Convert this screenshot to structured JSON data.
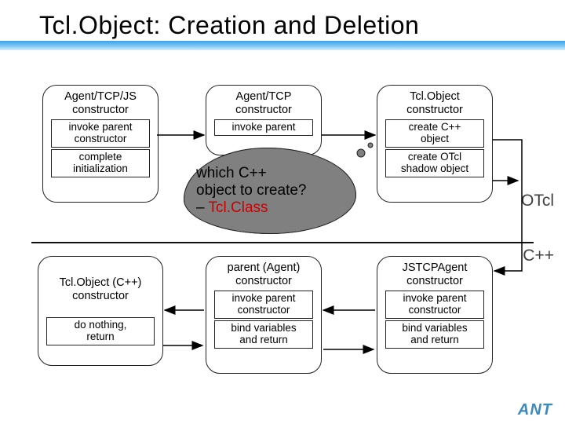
{
  "title": "Tcl.Object: Creation and Deletion",
  "nodes": {
    "n1": {
      "header": "Agent/TCP/JS\nconstructor",
      "subs": [
        "invoke parent\nconstructor",
        "complete\ninitialization"
      ]
    },
    "n2": {
      "header": "Agent/TCP\nconstructor",
      "subs": [
        "invoke parent"
      ]
    },
    "n3": {
      "header": "Tcl.Object\nconstructor",
      "subs": [
        "create C++\nobject",
        "create OTcl\nshadow object"
      ]
    },
    "n4": {
      "header": "Tcl.Object (C++)\nconstructor",
      "subs": [
        "do nothing,\nreturn"
      ]
    },
    "n5": {
      "header": "parent (Agent)\nconstructor",
      "subs": [
        "invoke parent\nconstructor",
        "bind variables\nand return"
      ]
    },
    "n6": {
      "header": "JSTCPAgent\nconstructor",
      "subs": [
        "invoke parent\nconstructor",
        "bind variables\nand return"
      ]
    }
  },
  "cloud": {
    "line1": "which C++",
    "line2": "object to create?",
    "dash": "–",
    "emph": "Tcl.Class"
  },
  "labels": {
    "otcl": "OTcl",
    "cpp": "C++"
  },
  "footer": "ANT"
}
